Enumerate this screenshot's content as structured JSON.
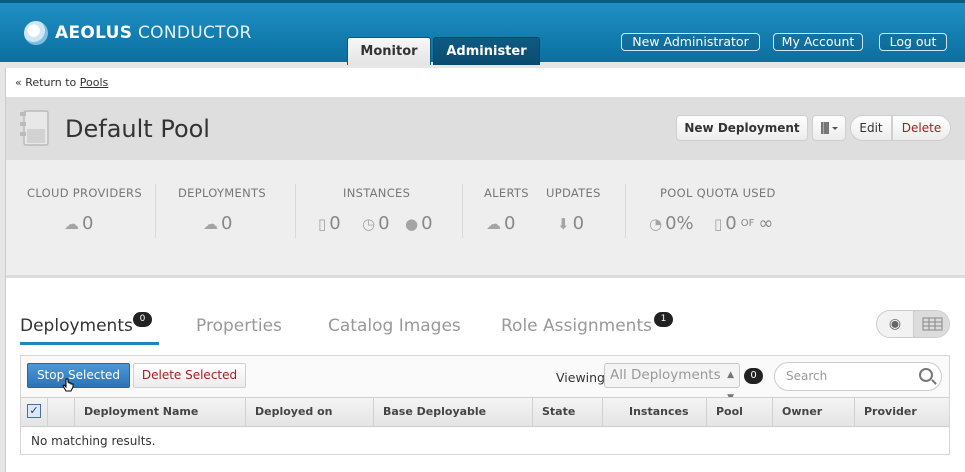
{
  "header": {
    "logo_bold": "AEOLUS",
    "logo_light": "CONDUCTOR",
    "tabs": [
      {
        "label": "Monitor",
        "active": true
      },
      {
        "label": "Administer",
        "active": false
      }
    ],
    "user_links": [
      "New Administrator",
      "My Account",
      "Log out"
    ]
  },
  "breadcrumb": {
    "prefix": "« Return to ",
    "link": "Pools"
  },
  "pool": {
    "title": "Default Pool",
    "actions": {
      "new_deployment": "New Deployment",
      "edit": "Edit",
      "delete": "Delete"
    }
  },
  "stats": {
    "cloud_providers": {
      "label": "CLOUD PROVIDERS",
      "value": "0"
    },
    "deployments": {
      "label": "DEPLOYMENTS",
      "value": "0"
    },
    "instances": {
      "label": "INSTANCES",
      "values": [
        "0",
        "0",
        "0"
      ]
    },
    "alerts": {
      "label": "ALERTS",
      "value": "0"
    },
    "updates": {
      "label": "UPDATES",
      "value": "0"
    },
    "quota": {
      "label": "POOL QUOTA USED",
      "percent": "0%",
      "used": "0",
      "of": "OF",
      "max": "∞"
    }
  },
  "tabs": [
    {
      "label": "Deployments",
      "badge": "0",
      "active": true
    },
    {
      "label": "Properties",
      "active": false
    },
    {
      "label": "Catalog Images",
      "active": false
    },
    {
      "label": "Role Assignments",
      "badge": "1",
      "active": false
    }
  ],
  "table": {
    "stop_selected": "Stop Selected",
    "delete_selected": "Delete Selected",
    "viewing_label": "Viewing",
    "viewing_value": "All Deployments",
    "count": "0",
    "search_placeholder": "Search",
    "columns": [
      "Deployment Name",
      "Deployed on",
      "Base Deployable",
      "State",
      "Instances",
      "Pool",
      "Owner",
      "Provider"
    ],
    "empty_message": "No matching results."
  },
  "colors": {
    "header_blue": "#1f8fc4",
    "primary_button": "#2b74b7",
    "danger_text": "#a32020",
    "tab_underline": "#1c86bf"
  }
}
